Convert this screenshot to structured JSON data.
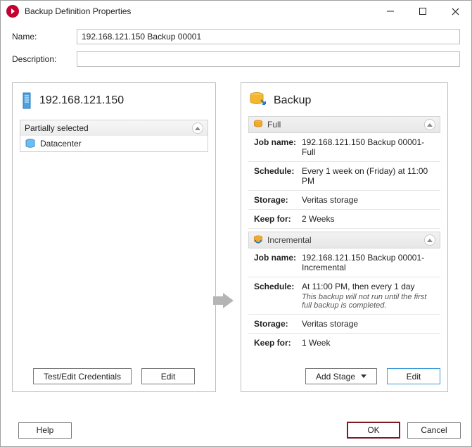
{
  "window": {
    "title": "Backup Definition Properties"
  },
  "form": {
    "name_label": "Name:",
    "name_value": "192.168.121.150 Backup 00001",
    "desc_label": "Description:",
    "desc_value": ""
  },
  "left": {
    "server": "192.168.121.150",
    "group_label": "Partially selected",
    "item": "Datacenter",
    "test_btn": "Test/Edit Credentials",
    "edit_btn": "Edit"
  },
  "right": {
    "title": "Backup",
    "full": {
      "header": "Full",
      "jobname_k": "Job name:",
      "jobname_v": "192.168.121.150 Backup 00001-Full",
      "schedule_k": "Schedule:",
      "schedule_v": "Every 1 week on (Friday) at 11:00 PM",
      "storage_k": "Storage:",
      "storage_v": "Veritas storage",
      "keep_k": "Keep for:",
      "keep_v": "2 Weeks"
    },
    "incr": {
      "header": "Incremental",
      "jobname_k": "Job name:",
      "jobname_v": "192.168.121.150 Backup 00001-Incremental",
      "schedule_k": "Schedule:",
      "schedule_v": "At 11:00 PM, then every 1 day",
      "schedule_note": "This backup will not run until the first full backup is completed.",
      "storage_k": "Storage:",
      "storage_v": "Veritas storage",
      "keep_k": "Keep for:",
      "keep_v": "1 Week"
    },
    "addstage_btn": "Add Stage",
    "edit_btn": "Edit"
  },
  "footer": {
    "help": "Help",
    "ok": "OK",
    "cancel": "Cancel"
  }
}
